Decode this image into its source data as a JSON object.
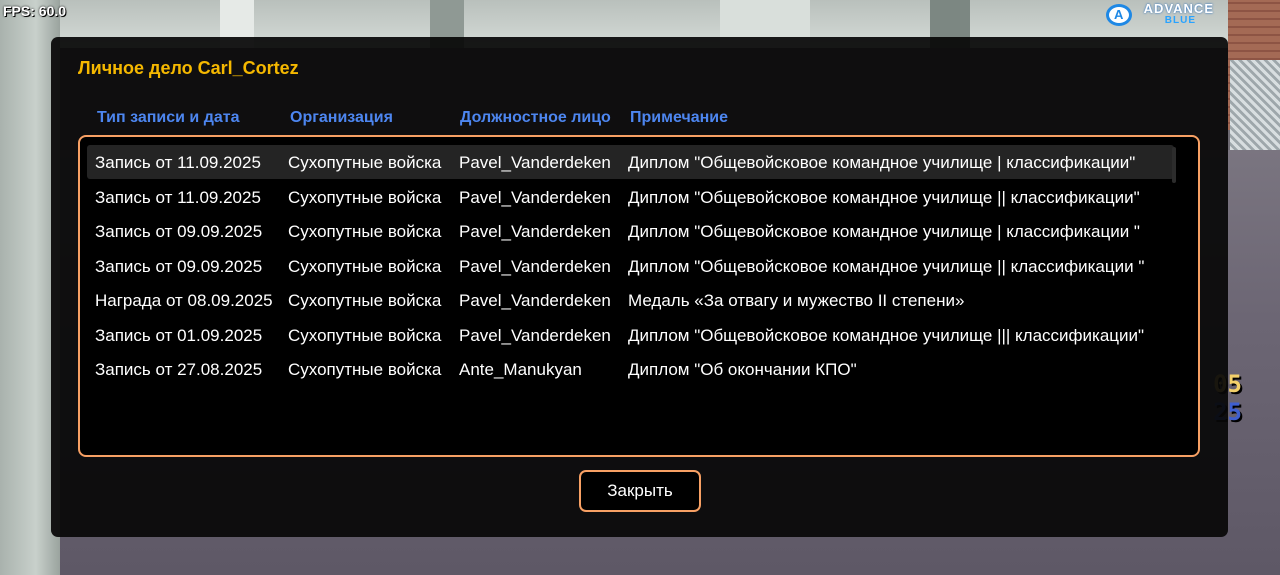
{
  "hud": {
    "fps_label": "FPS: 60.0",
    "logo": {
      "line1": "ADVANCE",
      "line2": "BLUE",
      "mark": "A"
    },
    "side_numbers": [
      "05",
      "25"
    ]
  },
  "dialog": {
    "title": "Личное дело Carl_Cortez",
    "columns": [
      "Тип записи и дата",
      "Организация",
      "Должностное лицо",
      "Примечание"
    ],
    "rows": [
      {
        "type_date": "Запись от 11.09.2025",
        "organization": "Сухопутные войска",
        "official": "Pavel_Vanderdeken",
        "note": "Диплом \"Общевойсковое командное училище | классификации\""
      },
      {
        "type_date": "Запись от 11.09.2025",
        "organization": "Сухопутные войска",
        "official": "Pavel_Vanderdeken",
        "note": "Диплом \"Общевойсковое командное училище || классификации\""
      },
      {
        "type_date": "Запись от 09.09.2025",
        "organization": "Сухопутные войска",
        "official": "Pavel_Vanderdeken",
        "note": "Диплом \"Общевойсковое командное училище | классификации \""
      },
      {
        "type_date": "Запись от 09.09.2025",
        "organization": "Сухопутные войска",
        "official": "Pavel_Vanderdeken",
        "note": "Диплом \"Общевойсковое командное училище || классификации \""
      },
      {
        "type_date": "Награда от 08.09.2025",
        "organization": "Сухопутные войска",
        "official": "Pavel_Vanderdeken",
        "note": "Медаль «За отвагу и мужество II степени»"
      },
      {
        "type_date": "Запись от 01.09.2025",
        "organization": "Сухопутные войска",
        "official": "Pavel_Vanderdeken",
        "note": "Диплом \"Общевойсковое командное училище ||| классификации\""
      },
      {
        "type_date": "Запись от 27.08.2025",
        "organization": "Сухопутные войска",
        "official": "Ante_Manukyan",
        "note": "Диплом \"Об окончании КПО\""
      }
    ],
    "selected_row": 0,
    "close_label": "Закрыть"
  },
  "colors": {
    "title": "#f5b800",
    "column_header": "#4d86f0",
    "border_accent": "#f7a064",
    "panel_bg": "#080808"
  }
}
